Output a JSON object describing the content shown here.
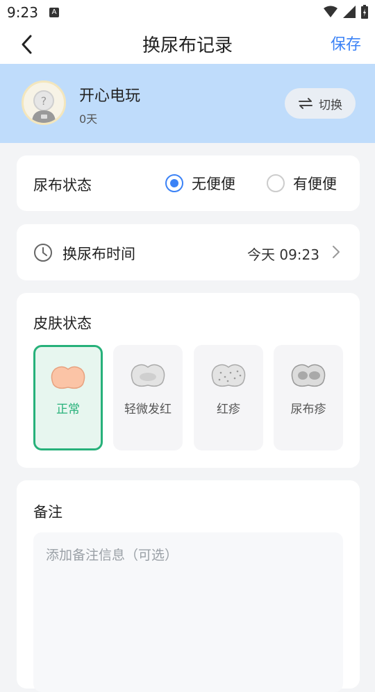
{
  "status": {
    "time": "9:23",
    "notif_letter": "A"
  },
  "header": {
    "title": "换尿布记录",
    "save_label": "保存"
  },
  "baby": {
    "name": "开心电玩",
    "age": "0天",
    "switch_label": "切换"
  },
  "diaper": {
    "label": "尿布状态",
    "options": [
      {
        "label": "无便便",
        "selected": true
      },
      {
        "label": "有便便",
        "selected": false
      }
    ]
  },
  "time_row": {
    "label": "换尿布时间",
    "value": "今天 09:23"
  },
  "skin": {
    "label": "皮肤状态",
    "options": [
      {
        "label": "正常",
        "selected": true
      },
      {
        "label": "轻微发红",
        "selected": false
      },
      {
        "label": "红疹",
        "selected": false
      },
      {
        "label": "尿布疹",
        "selected": false
      }
    ]
  },
  "notes": {
    "label": "备注",
    "placeholder": "添加备注信息（可选）"
  },
  "colors": {
    "accent": "#3b82f6",
    "selected_green": "#27b17a",
    "banner": "#bfdcfb"
  }
}
